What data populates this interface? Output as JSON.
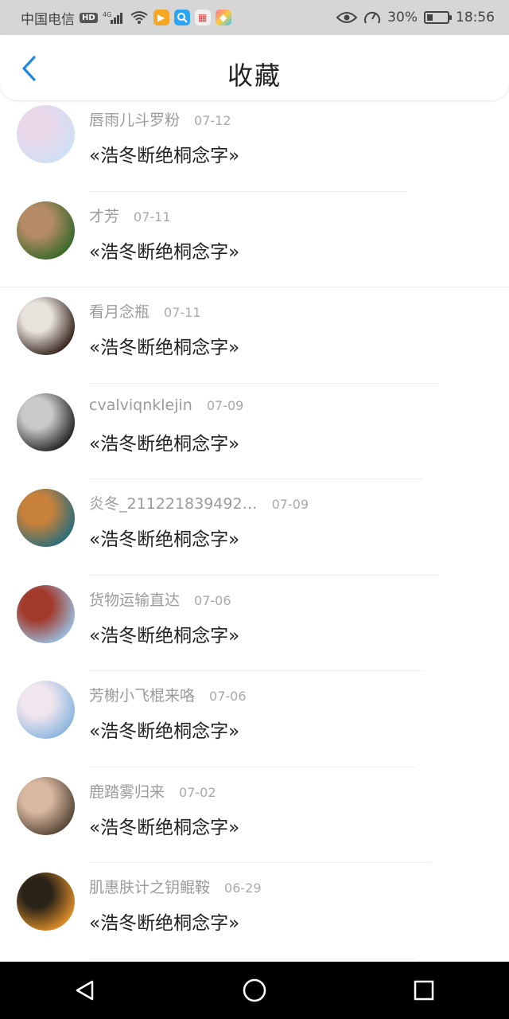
{
  "status_bar": {
    "carrier": "中国电信",
    "hd": "HD",
    "network": "4G",
    "battery_percent": "30%",
    "time": "18:56",
    "battery_level": 0.3
  },
  "header": {
    "title": "收藏"
  },
  "items": [
    {
      "user": "唇雨儿斗罗粉",
      "date": "07-12",
      "title": "«浩冬断绝桐念字»",
      "avatar": "anime-girl-avatar",
      "colors": [
        "#cfe0f4",
        "#e9d7ea"
      ]
    },
    {
      "user": "才芳",
      "date": "07-11",
      "title": "«浩冬断绝桐念字»",
      "avatar": "children-photo-avatar",
      "colors": [
        "#3b6b2c",
        "#b58a66"
      ]
    },
    {
      "user": "看月念瓶",
      "date": "07-11",
      "title": "«浩冬断绝桐念字»",
      "avatar": "child-photo-avatar",
      "colors": [
        "#3a2a22",
        "#e8e2dc"
      ]
    },
    {
      "user": "cvalviqnklejin",
      "date": "07-09",
      "title": "«浩冬断绝桐念字»",
      "avatar": "woman-portrait-avatar",
      "colors": [
        "#2a2a2a",
        "#c9c9c9"
      ]
    },
    {
      "user": "炎冬_211221839492…",
      "date": "07-09",
      "title": "«浩冬断绝桐念字»",
      "avatar": "cartoon-bear-avatar",
      "colors": [
        "#2f6e7a",
        "#c7813a"
      ]
    },
    {
      "user": "货物运输直达",
      "date": "07-06",
      "title": "«浩冬断绝桐念字»",
      "avatar": "truck-photo-avatar",
      "colors": [
        "#9ab8d8",
        "#a23a2a"
      ]
    },
    {
      "user": "芳榭小飞棍来咯",
      "date": "07-06",
      "title": "«浩冬断绝桐念字»",
      "avatar": "anime-character-avatar",
      "colors": [
        "#8fb8e0",
        "#f2e6ee"
      ]
    },
    {
      "user": "鹿踏雾归来",
      "date": "07-02",
      "title": "«浩冬断绝桐念字»",
      "avatar": "girl-photo-avatar",
      "colors": [
        "#5a4a38",
        "#d9b8a2"
      ]
    },
    {
      "user": "肌惠肤计之钥鲲鞍",
      "date": "06-29",
      "title": "«浩冬断绝桐念字»",
      "avatar": "tiger-photo-avatar",
      "colors": [
        "#d98a2a",
        "#2a2418"
      ]
    }
  ],
  "nav": {
    "back_icon": "triangle-back-icon",
    "home_icon": "circle-home-icon",
    "recents_icon": "square-recents-icon"
  },
  "colors": {
    "accent": "#1e88e5",
    "status_bar_bg": "#d6d6d6",
    "nav_bar_bg": "#000000"
  }
}
